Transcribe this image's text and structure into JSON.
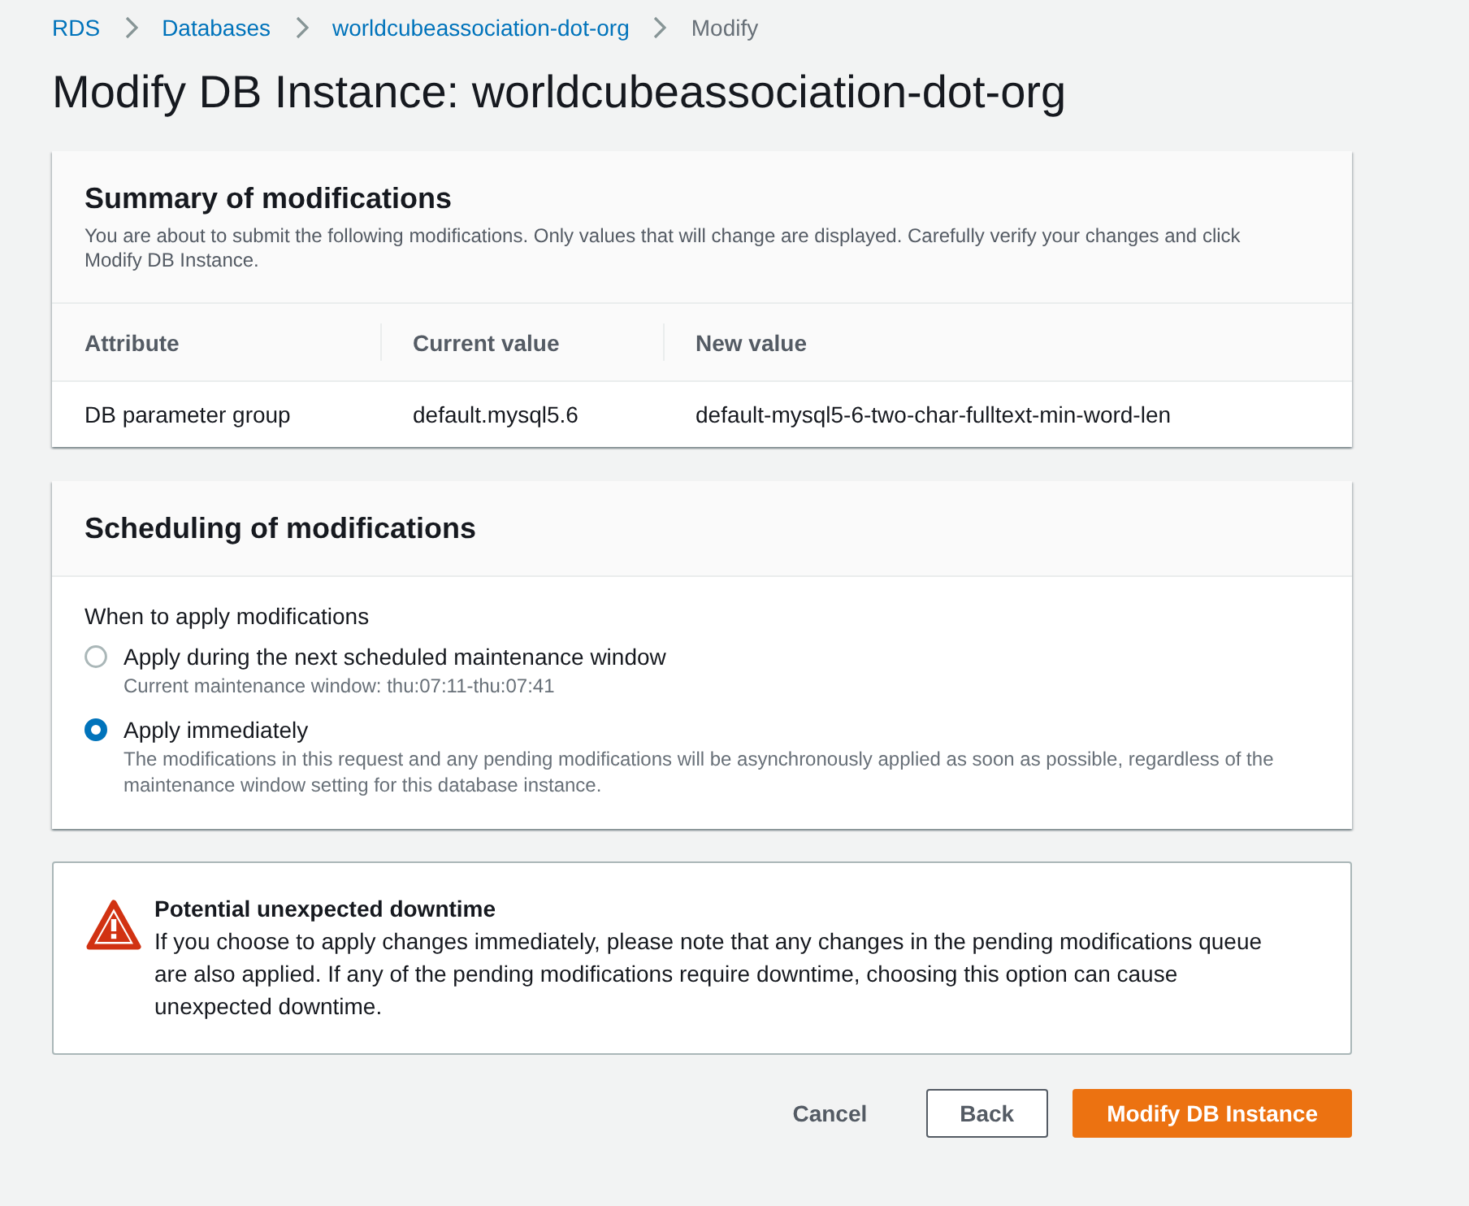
{
  "breadcrumbs": [
    {
      "label": "RDS",
      "kind": "link"
    },
    {
      "label": "Databases",
      "kind": "link"
    },
    {
      "label": "worldcubeassociation-dot-org",
      "kind": "link"
    },
    {
      "label": "Modify",
      "kind": "current"
    }
  ],
  "page_title": "Modify DB Instance: worldcubeassociation-dot-org",
  "summary": {
    "title": "Summary of modifications",
    "description": "You are about to submit the following modifications. Only values that will change are displayed. Carefully verify your changes and click Modify DB Instance.",
    "table": {
      "columns": [
        "Attribute",
        "Current value",
        "New value"
      ],
      "rows": [
        [
          "DB parameter group",
          "default.mysql5.6",
          "default-mysql5-6-two-char-fulltext-min-word-len"
        ]
      ]
    }
  },
  "scheduling": {
    "title": "Scheduling of modifications",
    "field_label": "When to apply modifications",
    "options": [
      {
        "label": "Apply during the next scheduled maintenance window",
        "description": "Current maintenance window: thu:07:11-thu:07:41",
        "selected": false
      },
      {
        "label": "Apply immediately",
        "description": "The modifications in this request and any pending modifications will be asynchronously applied as soon as possible, regardless of the maintenance window setting for this database instance.",
        "selected": true
      }
    ]
  },
  "alert": {
    "kind": "warning",
    "title": "Potential unexpected downtime",
    "message": "If you choose to apply changes immediately, please note that any changes in the pending modifications queue are also applied. If any of the pending modifications require downtime, choosing this option can cause unexpected downtime."
  },
  "buttons": [
    {
      "label": "Cancel",
      "kind": "link"
    },
    {
      "label": "Back",
      "kind": "normal"
    },
    {
      "label": "Modify DB Instance",
      "kind": "primary"
    }
  ]
}
